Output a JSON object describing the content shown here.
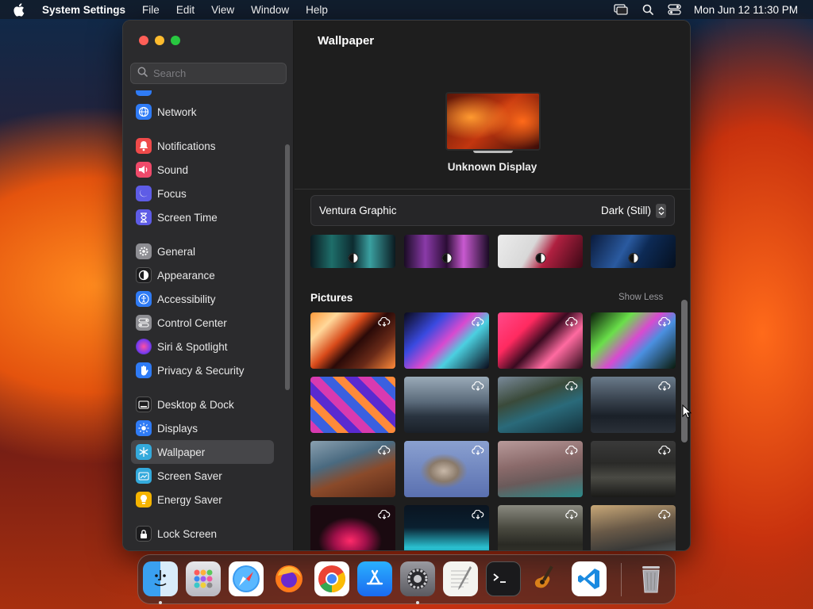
{
  "menubar": {
    "app_name": "System Settings",
    "menus": [
      "File",
      "Edit",
      "View",
      "Window",
      "Help"
    ],
    "clock": "Mon Jun 12  11:30 PM"
  },
  "sidebar": {
    "search_placeholder": "Search",
    "items": [
      {
        "label": "Network",
        "icon": "globe-icon",
        "color": "#2f7bf5"
      },
      {
        "label": "Notifications",
        "icon": "bell-icon",
        "color": "#ef4a4a"
      },
      {
        "label": "Sound",
        "icon": "speaker-icon",
        "color": "#ef4a6a"
      },
      {
        "label": "Focus",
        "icon": "moon-icon",
        "color": "#5e5ce6"
      },
      {
        "label": "Screen Time",
        "icon": "hourglass-icon",
        "color": "#5e5ce6"
      },
      {
        "label": "General",
        "icon": "gear-icon",
        "color": "#8e8e93"
      },
      {
        "label": "Appearance",
        "icon": "appearance-icon",
        "color": "#1c1c1e"
      },
      {
        "label": "Accessibility",
        "icon": "accessibility-icon",
        "color": "#2f7bf5"
      },
      {
        "label": "Control Center",
        "icon": "toggles-icon",
        "color": "#8e8e93"
      },
      {
        "label": "Siri & Spotlight",
        "icon": "siri-icon",
        "color": "#6b3bd6"
      },
      {
        "label": "Privacy & Security",
        "icon": "hand-icon",
        "color": "#2f7bf5"
      },
      {
        "label": "Desktop & Dock",
        "icon": "dock-icon",
        "color": "#1c1c1e"
      },
      {
        "label": "Displays",
        "icon": "sun-icon",
        "color": "#2f7bf5"
      },
      {
        "label": "Wallpaper",
        "icon": "snowflake-icon",
        "color": "#34aadc"
      },
      {
        "label": "Screen Saver",
        "icon": "screensaver-icon",
        "color": "#34aadc"
      },
      {
        "label": "Energy Saver",
        "icon": "bulb-icon",
        "color": "#f5b400"
      },
      {
        "label": "Lock Screen",
        "icon": "lock-icon",
        "color": "#1c1c1e"
      }
    ],
    "selected": "Wallpaper"
  },
  "content": {
    "title": "Wallpaper",
    "display_name": "Unknown Display",
    "wallpaper_name": "Ventura Graphic",
    "style_value": "Dark (Still)",
    "pictures_header": "Pictures",
    "show_less_label": "Show Less"
  },
  "dock": {
    "apps": [
      "Finder",
      "Launchpad",
      "Safari",
      "Firefox",
      "Chrome",
      "App Store",
      "System Settings",
      "TextEdit",
      "Terminal",
      "GarageBand",
      "Visual Studio Code",
      "Trash"
    ]
  }
}
